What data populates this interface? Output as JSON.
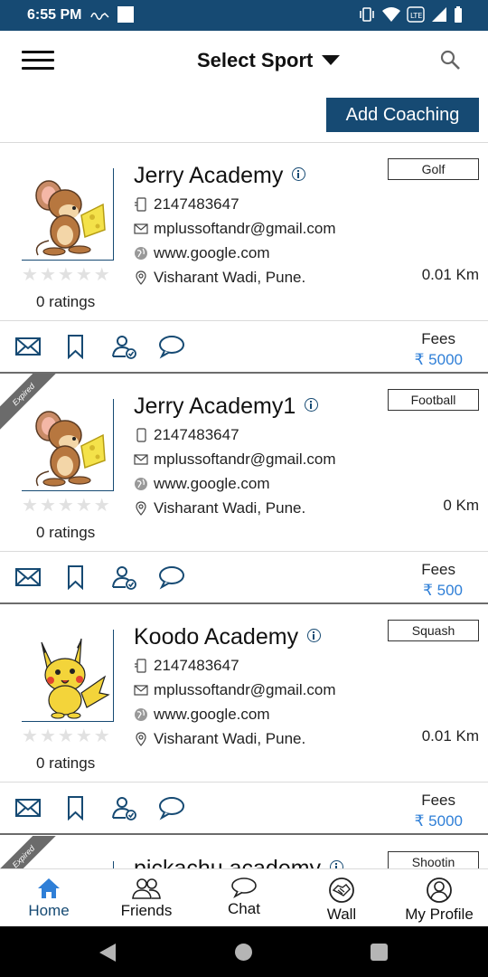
{
  "status_bar": {
    "time": "6:55 PM"
  },
  "header": {
    "title": "Select Sport"
  },
  "add_coaching_label": "Add Coaching",
  "academies": [
    {
      "name": "Jerry Academy",
      "sport": "Golf",
      "phone": "2147483647",
      "email": "mplussoftandr@gmail.com",
      "website": "www.google.com",
      "location": "Visharant Wadi, Pune.",
      "distance": "0.01 Km",
      "ratings": "0 ratings",
      "fees_label": "Fees",
      "fees": "₹ 5000",
      "image": "jerry-mouse-cartoon",
      "expired": ""
    },
    {
      "name": "Jerry Academy1",
      "sport": "Football",
      "phone": "2147483647",
      "email": "mplussoftandr@gmail.com",
      "website": "www.google.com",
      "location": "Visharant Wadi, Pune.",
      "distance": "0 Km",
      "ratings": "0 ratings",
      "fees_label": "Fees",
      "fees": "₹ 500",
      "image": "jerry-mouse-cartoon",
      "expired": "Expired"
    },
    {
      "name": "Koodo Academy",
      "sport": "Squash",
      "phone": "2147483647",
      "email": "mplussoftandr@gmail.com",
      "website": "www.google.com",
      "location": "Visharant Wadi, Pune.",
      "distance": "0.01 Km",
      "ratings": "0 ratings",
      "fees_label": "Fees",
      "fees": "₹ 5000",
      "image": "pikachu-cartoon",
      "expired": ""
    },
    {
      "name": "pickachu academy",
      "sport": "Shootin",
      "expired": "Expired"
    }
  ],
  "bottom_nav": [
    {
      "label": "Home",
      "icon": "home-icon",
      "active": true
    },
    {
      "label": "Friends",
      "icon": "friends-icon"
    },
    {
      "label": "Chat",
      "icon": "chat-icon"
    },
    {
      "label": "Wall",
      "icon": "handshake-icon"
    },
    {
      "label": "My Profile",
      "icon": "profile-icon"
    }
  ],
  "colors": {
    "primary": "#164a73",
    "price": "#2f7fd7",
    "star_empty": "#e1e1e1",
    "nav_active": "#2f7fd7"
  }
}
